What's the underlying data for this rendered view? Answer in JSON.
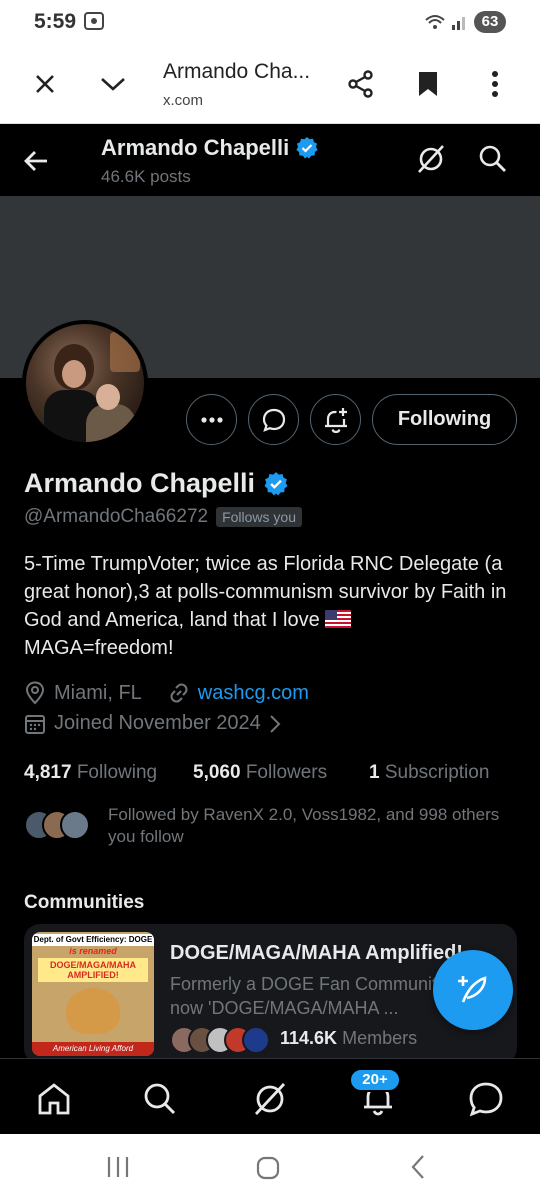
{
  "status_bar": {
    "time": "5:59",
    "battery": "63"
  },
  "tab_bar": {
    "title": "Armando Cha...",
    "url": "x.com"
  },
  "profile_header": {
    "name": "Armando Chapelli",
    "posts": "46.6K posts"
  },
  "profile": {
    "name": "Armando Chapelli",
    "handle": "@ArmandoCha66272",
    "follows_you": "Follows you",
    "following_button": "Following",
    "bio_line1": "5-Time TrumpVoter; twice as Florida RNC Delegate (a great honor),3 at polls-communism survivor by Faith in God and America, land that I love ",
    "bio_line2": "MAGA=freedom!",
    "location": "Miami, FL",
    "website": "washcg.com",
    "joined": "Joined November 2024",
    "following_count": "4,817",
    "following_label": "Following",
    "followers_count": "5,060",
    "followers_label": "Followers",
    "subscription_count": "1",
    "subscription_label": "Subscription",
    "followed_by": "Followed by RavenX 2.0, Voss1982, and 998 others you follow"
  },
  "communities": {
    "heading": "Communities",
    "card": {
      "title": "DOGE/MAGA/MAHA Amplified!",
      "description": "Formerly a DOGE Fan Community, now 'DOGE/MAGA/MAHA ...",
      "members_count": "114.6K",
      "members_label": "Members",
      "cover_line1": "Dept. of Govt Efficiency: DOGE",
      "cover_line2": "is renamed",
      "cover_line3": "DOGE/MAGA/MAHA AMPLIFIED!",
      "cover_bottom": "American Living Afford"
    }
  },
  "bottom_nav": {
    "notifications_badge": "20+"
  },
  "colors": {
    "accent": "#1d9bf0",
    "background": "#000000",
    "muted": "#71767b",
    "text": "#e7e9ea"
  }
}
